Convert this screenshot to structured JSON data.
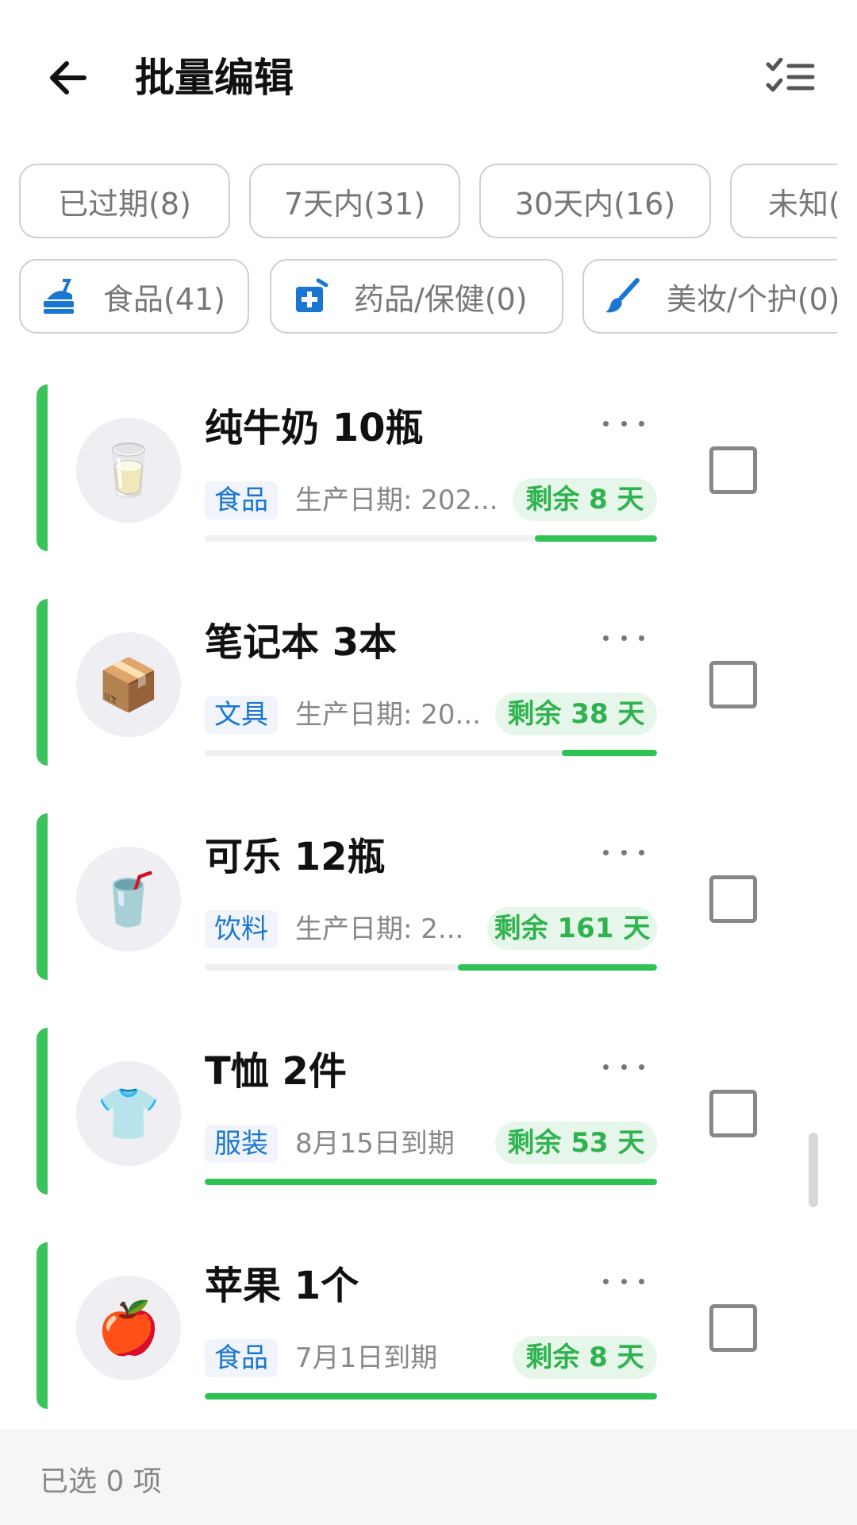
{
  "header": {
    "title": "批量编辑",
    "back_icon": "arrow-left-icon",
    "select_icon": "checklist-icon"
  },
  "filters": {
    "time_chips": [
      {
        "label": "已过期(8)"
      },
      {
        "label": "7天内(31)"
      },
      {
        "label": "30天内(16)"
      },
      {
        "label": "未知("
      }
    ],
    "category_chips": [
      {
        "label": "食品(41)",
        "icon": "food-icon",
        "icon_color": "#1976d2"
      },
      {
        "label": "药品/保健(0)",
        "icon": "medicine-icon",
        "icon_color": "#1976d2"
      },
      {
        "label": "美妆/个护(0)",
        "icon": "brush-icon",
        "icon_color": "#1976d2"
      }
    ]
  },
  "items": [
    {
      "title": "纯牛奶 10瓶",
      "emoji": "🥛",
      "category": "食品",
      "meta": "生产日期: 202...",
      "remaining": "剩余 8 天",
      "progress": 0.27
    },
    {
      "title": "笔记本 3本",
      "emoji": "📦",
      "category": "文具",
      "meta": "生产日期: 20...",
      "remaining": "剩余 38 天",
      "progress": 0.21
    },
    {
      "title": "可乐 12瓶",
      "emoji": "🥤",
      "category": "饮料",
      "meta": "生产日期: 2...",
      "remaining": "剩余 161 天",
      "progress": 0.44
    },
    {
      "title": "T恤 2件",
      "emoji": "👕",
      "category": "服装",
      "meta": "8月15日到期",
      "remaining": "剩余 53 天",
      "progress": 1.0
    },
    {
      "title": "苹果 1个",
      "emoji": "🍎",
      "category": "食品",
      "meta": "7月1日到期",
      "remaining": "剩余 8 天",
      "progress": 1.0
    }
  ],
  "footer": {
    "selected_text": "已选 0 项"
  },
  "colors": {
    "accent_green": "#3ac45b",
    "badge_blue": "#1976d2",
    "remain_green": "#2fb34e"
  }
}
